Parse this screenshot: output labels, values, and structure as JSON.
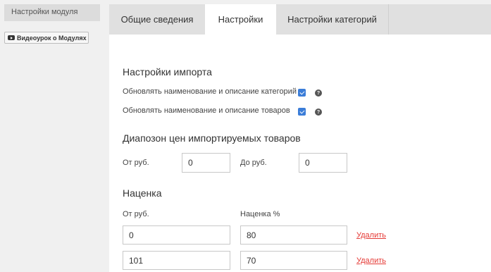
{
  "sidebar": {
    "item_label": "Настройки модуля",
    "video_button_label": "Видеоурок о Модулях"
  },
  "tabs": [
    {
      "label": "Общие сведения",
      "active": false
    },
    {
      "label": "Настройки",
      "active": true
    },
    {
      "label": "Настройки категорий",
      "active": false
    }
  ],
  "import_settings": {
    "title": "Настройки импорта",
    "options": [
      {
        "label": "Обновлять наименование и описание категорий",
        "checked": true
      },
      {
        "label": "Обновлять наименование и описание товаров",
        "checked": true
      }
    ],
    "help_symbol": "?"
  },
  "price_range": {
    "title": "Диапозон цен импортируемых товаров",
    "from_label": "От руб.",
    "from_value": "0",
    "to_label": "До руб.",
    "to_value": "0"
  },
  "markup": {
    "title": "Наценка",
    "col_from_label": "От руб.",
    "col_markup_label": "Наценка %",
    "rows": [
      {
        "from": "0",
        "markup": "80",
        "delete_label": "Удалить"
      },
      {
        "from": "101",
        "markup": "70",
        "delete_label": "Удалить"
      }
    ]
  },
  "colors": {
    "accent": "#3b7dd8",
    "delete": "#e53935"
  }
}
